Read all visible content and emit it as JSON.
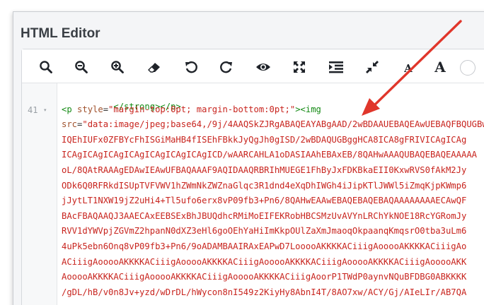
{
  "panel": {
    "title": "HTML Editor"
  },
  "toolbar": {
    "buttons": [
      {
        "name": "search-icon"
      },
      {
        "name": "zoom-out-icon"
      },
      {
        "name": "zoom-in-icon"
      },
      {
        "name": "eraser-icon"
      },
      {
        "name": "undo-icon"
      },
      {
        "name": "redo-icon"
      },
      {
        "name": "eye-icon"
      },
      {
        "name": "expand-icon"
      },
      {
        "name": "indent-icon"
      },
      {
        "name": "collapse-icon"
      },
      {
        "name": "font-decrease-icon"
      },
      {
        "name": "font-increase-icon"
      }
    ],
    "font_small_label": "A",
    "font_large_label": "A"
  },
  "gutter": {
    "line_number": "41",
    "fold_marker": "▾"
  },
  "code": {
    "line1": "</strong></p>",
    "line2_tag_open": "<p ",
    "line2_attr": "style",
    "line2_eq": "=",
    "line2_val": "\"margin-top:0pt; margin-bottom:0pt;\"",
    "line2_tag_close": "><img",
    "line3_attr": "src",
    "line3_eq": "=",
    "line3_val": "\"data:image/jpeg;base64,/9j/4AAQSkZJRgABAQEAYABgAAD/2wBDAAUEBAQEAwUEBAQFBQUGBw",
    "lines": [
      "IQEhIUFx0ZFBYcFhISGiMaHB4fISEhFBkkJyQgJh0gISD/2wBDAQUGBggHCA8ICA8gFRIVICAgICAg",
      "ICAgICAgICAgICAgICAgICAgICAgICD/wAARCAHLA1oDASIAAhEBAxEB/8QAHwAAAQUBAQEBAQEAAAAA",
      "oL/8QAtRAAAgEDAwIEAwUFBAQAAAF9AQIDAAQRBRIhMUEGE1FhByJxFDKBkaEII0KxwRVS0fAkM2Jy",
      "ODk6Q0RFRkdISUpTVFVWV1hZWmNkZWZnaGlqc3R1dnd4eXqDhIWGh4iJipKTlJWWl5iZmqKjpKWmp6",
      "jJytLT1NXW19jZ2uHi4+Tl5ufo6erx8vP09fb3+Pn6/8QAHwEAAwEBAQEBAQEBAQAAAAAAAAECAwQF",
      "BAcFBAQAAQJ3AAECAxEEBSExBhJBUQdhcRMiMoEIFEKRobHBCSMzUvAVYnLRChYkNOE18RcYGRomJy",
      "RVV1dYWVpjZGVmZ2hpanN0dXZ3eHl6goOEhYaHiImKkpOUlZaXmJmaoqOkpaanqKmqsrO0tba3uLm6",
      "4uPk5ebn6Onq8vP09fb3+Pn6/9oADAMBAAIRAxEAPwD7LooooAKKKKACiiigAooooAKKKKACiiigAo",
      "ACiiigAooooAKKKKACiiigAooooAKKKKACiiigAooooAKKKKACiiigAooooAKKKKACiiigAooooAKK",
      "AooooAKKKKACiiigAooooAKKKKACiiigAooooAKKKKACiiigAoorP1TWdP0aynvNQuBFDBG0ABKKKK",
      "/gDL/hB/v0n8Jv+yzd/wDrDL/hWycon8nI549z2KiyHy8AbnI4T/8AO7xw/ACY/Gj/AIeLIr/AB7QA"
    ]
  },
  "colors": {
    "tag": "#148a14",
    "attr": "#a0522d",
    "string": "#c8241e",
    "arrow": "#e0362b"
  }
}
